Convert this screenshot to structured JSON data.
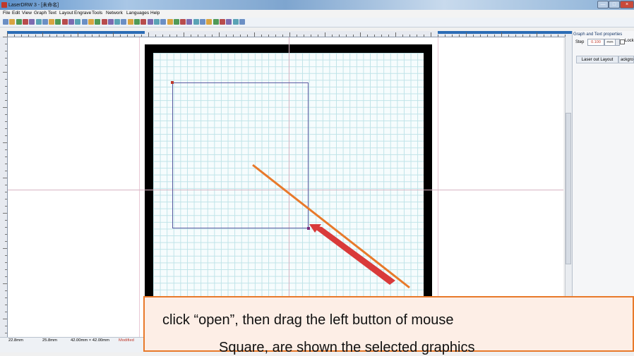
{
  "window": {
    "title": "LaserDRW 3 - [未命名]",
    "controls": {
      "minimize": "—",
      "maximize": "□",
      "close": "×"
    }
  },
  "menu": {
    "items": [
      "File",
      "Edit",
      "View",
      "Graph",
      "Text",
      "Layout",
      "Engrave",
      "Tools",
      "Network",
      "Languages",
      "Help"
    ]
  },
  "toolbar": {
    "icons": [
      "new-icon",
      "open-icon",
      "save-icon",
      "import-icon",
      "export-icon",
      "settings-icon",
      "gear-icon",
      "cut-icon",
      "copy-icon",
      "paste-icon",
      "delete-icon",
      "grid-icon",
      "select-icon",
      "zoom-in-icon",
      "zoom-out-icon",
      "zoom-fit-icon",
      "pan-icon",
      "pointer-icon",
      "line-icon",
      "rectangle-icon",
      "ellipse-icon",
      "polygon-icon",
      "star-icon",
      "bezier-icon",
      "text-icon",
      "align-icon",
      "distribute-icon",
      "group-icon",
      "ungroup-icon",
      "engrave-icon",
      "cut-run-icon",
      "stop-icon",
      "pause-icon",
      "home-icon",
      "laser-icon",
      "device-icon",
      "preview-icon"
    ]
  },
  "side_panel": {
    "title": "Graph and Text properties",
    "step_label": "Step",
    "step_value": "0.100",
    "step_unit": "mm",
    "lock_label": "Lock",
    "tab_layout": "Laser out Layout",
    "tab_background": "ackgro"
  },
  "status_bar": {
    "x_pos": "22.8mm",
    "y_pos": "25.8mm",
    "size": "42.00mm × 42.00mm",
    "state": "Modified"
  },
  "caption": {
    "line1": "click “open”, then drag the left button of mouse",
    "line2": "Square, are shown the selected graphics"
  },
  "colors": {
    "annotation_line": "#e8792a",
    "annotation_arrow": "#d93a3a",
    "page_border": "#000000",
    "grid": "#bfe3e8"
  }
}
